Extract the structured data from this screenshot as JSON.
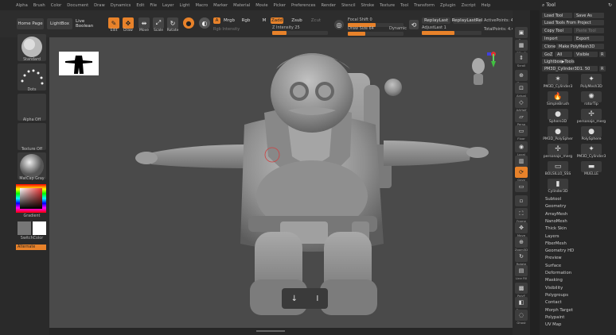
{
  "menu": [
    "Alpha",
    "Brush",
    "Color",
    "Document",
    "Draw",
    "Dynamics",
    "Edit",
    "File",
    "Layer",
    "Light",
    "Macro",
    "Marker",
    "Material",
    "Movie",
    "Picker",
    "Preferences",
    "Render",
    "Stencil",
    "Stroke",
    "Texture",
    "Tool",
    "Transform",
    "Zplugin",
    "Zscript",
    "Help"
  ],
  "toolbar": {
    "home_page": "Home Page",
    "lightbox": "LightBox",
    "live_boolean": "Live Boolean",
    "edit": "Edit",
    "draw": "Draw",
    "move": "Move",
    "scale": "Scale",
    "rotate": "Rotate",
    "a": "A",
    "mrgb": "Mrgb",
    "rgb": "Rgb",
    "m": "M",
    "rgb_intensity": "Rgb Intensity",
    "zadd": "Zadd",
    "zsub": "Zsub",
    "zcut": "Zcut",
    "z_intensity": "Z Intensity 25",
    "z_intensity_value": 25,
    "focal_shift": "Focal Shift 0",
    "draw_size": "Draw Size 64",
    "draw_size_value": 64,
    "dynamic": "Dynamic",
    "replay_last": "ReplayLast",
    "replay_last_rel": "ReplayLastRel",
    "adjust_last": "AdjustLast 1",
    "active_points": "ActivePoints: 4.400 Mil",
    "total_points": "TotalPoints: 4.400 Mil"
  },
  "left_panel": {
    "standard": "Standard",
    "dots": "Dots",
    "alpha_off": "Alpha Off",
    "texture_off": "Texture Off",
    "matcap": "MatCap Gray",
    "gradient": "Gradient",
    "switch_color": "SwitchColor",
    "alternate": "Alternate"
  },
  "shelf": [
    "Bpr",
    "SPix 3",
    "Scroll",
    "Zoom",
    "Actual",
    "AAHalf",
    "Persp",
    "Floor",
    "Local",
    "",
    "Gxyz",
    "",
    "",
    "Frame",
    "Move",
    "Zoom3D",
    "Rotate",
    "Line Fill",
    "PolyF",
    "Transp",
    "Ghost",
    "Solo",
    "Xpose"
  ],
  "tool": {
    "title": "Tool",
    "load_tool": "Load Tool",
    "save_as": "Save As",
    "load_from_project": "Load Tools From Project",
    "copy_tool": "Copy Tool",
    "paste_tool": "Paste Tool",
    "import": "Import",
    "export": "Export",
    "clone": "Clone",
    "make_polymesh": "Make PolyMesh3D",
    "goz": "GoZ",
    "all": "All",
    "visible": "Visible",
    "r": "R",
    "lightbox_tools": "Lightbox▶Tools",
    "current": "PM3D_Cylinder3D1. 50",
    "r2": "R",
    "thumbs": [
      "PM3D_Cylinder3",
      "PolyMesh3D",
      "SimpleBrush",
      "rotorTip",
      "Sphere3D",
      "personaje_merg",
      "PM3D_PolySpher",
      "PolySphere",
      "personaje_merg",
      "PM3D_Cylinder3",
      "BOLSILLO_SSS",
      "MUELLE",
      "Cylinder3D"
    ],
    "subpalettes": [
      "Subtool",
      "Geometry",
      "ArrayMesh",
      "NanoMesh",
      "Thick Skin",
      "Layers",
      "FiberMesh",
      "Geometry HD",
      "Preview",
      "Surface",
      "Deformation",
      "Masking",
      "Visibility",
      "Polygroups",
      "Contact",
      "Morph Target",
      "Polypaint",
      "UV Map"
    ]
  },
  "colors": {
    "accent": "#e8822a",
    "canvas": "#4a4a4a",
    "panel": "#2a2a2a"
  }
}
